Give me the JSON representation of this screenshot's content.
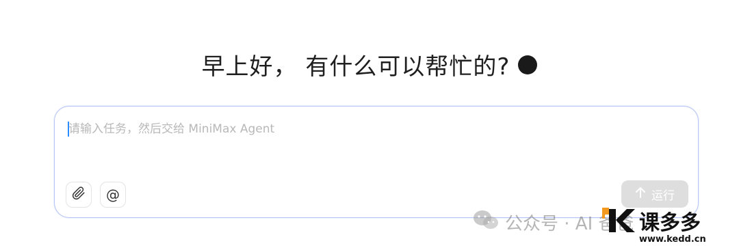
{
  "greeting": {
    "text": "早上好， 有什么可以帮忙的?"
  },
  "composer": {
    "placeholder": "请输入任务，然后交给 MiniMax Agent",
    "value": "",
    "run_label": "运行"
  },
  "icons": {
    "status": "status-dot-icon",
    "attach": "paperclip-icon",
    "mention": "at-sign-icon",
    "run": "arrow-up-icon",
    "watermark": "wechat-icon"
  },
  "watermark": {
    "text": "公众号 · AI 爸爸",
    "logo_text": "课多多",
    "logo_url_text": "www.kedd.cn"
  },
  "colors": {
    "accent_border": "#b9c3f5",
    "run_button": "#dedede",
    "caret": "#2b8cff",
    "logo_orange": "#f39a1e"
  }
}
